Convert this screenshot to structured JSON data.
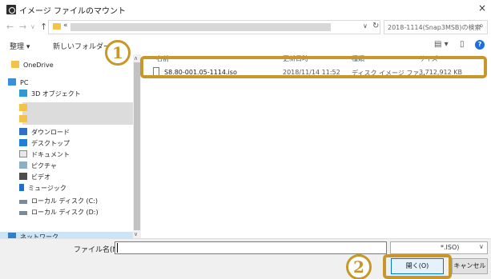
{
  "window": {
    "title": "イメージ ファイルのマウント",
    "close_glyph": "×"
  },
  "address": {
    "prefix": "«",
    "search_placeholder": "2018-1114(Snap3MSB)の検索",
    "refresh_glyph": "↻",
    "dropdown_glyph": "∨"
  },
  "toolbar": {
    "organize_label": "整理 ▾",
    "new_folder_label": "新しいフォルダー",
    "view_glyph": "▤ ▾",
    "pane_glyph": "▯",
    "help_glyph": "?"
  },
  "nav": {
    "items": [
      {
        "label": "OneDrive",
        "icon": "folder-icon"
      },
      {
        "label": "PC",
        "icon": "computer-icon"
      },
      {
        "label": "3D オブジェクト",
        "icon": "3d-objects-icon"
      },
      {
        "label": "",
        "icon": "folder-icon"
      },
      {
        "label": "",
        "icon": "folder-icon"
      },
      {
        "label": "ダウンロード",
        "icon": "download-icon"
      },
      {
        "label": "デスクトップ",
        "icon": "desktop-icon"
      },
      {
        "label": "ドキュメント",
        "icon": "document-icon"
      },
      {
        "label": "ピクチャ",
        "icon": "pictures-icon"
      },
      {
        "label": "ビデオ",
        "icon": "video-icon"
      },
      {
        "label": "ミュージック",
        "icon": "music-icon"
      },
      {
        "label": "ローカル ディスク (C:)",
        "icon": "drive-icon"
      },
      {
        "label": "ローカル ディスク (D:)",
        "icon": "drive-icon"
      },
      {
        "label": "ネットワーク",
        "icon": "network-icon"
      }
    ]
  },
  "files": {
    "columns": [
      "名前",
      "更新日時",
      "種類",
      "サイズ"
    ],
    "rows": [
      {
        "name": "S8.80-001.05-1114.iso",
        "modified": "2018/11/14 11:52",
        "type": "ディスク イメージ ファ...",
        "size": "3,712,912 KB"
      }
    ]
  },
  "bottom": {
    "filename_label": "ファイル名(N):",
    "filename_value": "",
    "filter_value": "*.ISO)",
    "open_label": "開く(O)",
    "cancel_label": "キャンセル"
  },
  "callouts": {
    "one": "1",
    "two": "2",
    "accent": "#c8972a"
  }
}
